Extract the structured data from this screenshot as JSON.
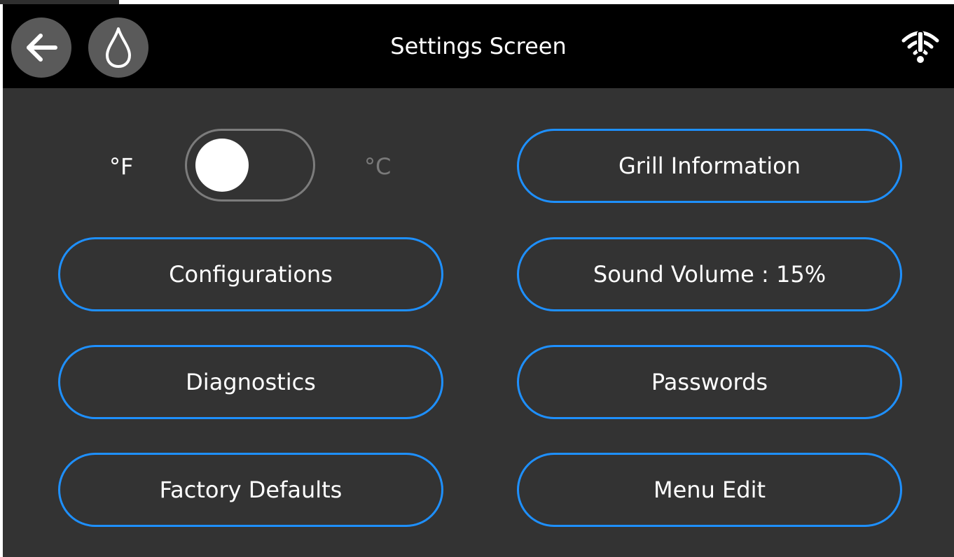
{
  "header": {
    "title": "Settings Screen",
    "back_icon": "back-arrow-icon",
    "flame_icon": "flame-icon",
    "wifi_icon": "wifi-alert-icon"
  },
  "units": {
    "fahrenheit_label": "°F",
    "celsius_label": "°C",
    "selected": "°F"
  },
  "buttons": {
    "grill_information": "Grill Information",
    "configurations": "Configurations",
    "sound_volume": "Sound Volume : 15%",
    "diagnostics": "Diagnostics",
    "passwords": "Passwords",
    "factory_defaults": "Factory Defaults",
    "menu_edit": "Menu Edit"
  },
  "colors": {
    "accent": "#1e90ff",
    "header_bg": "#000000",
    "panel_bg": "#333333",
    "text": "#ffffff",
    "muted_text": "#7a7a7a"
  }
}
